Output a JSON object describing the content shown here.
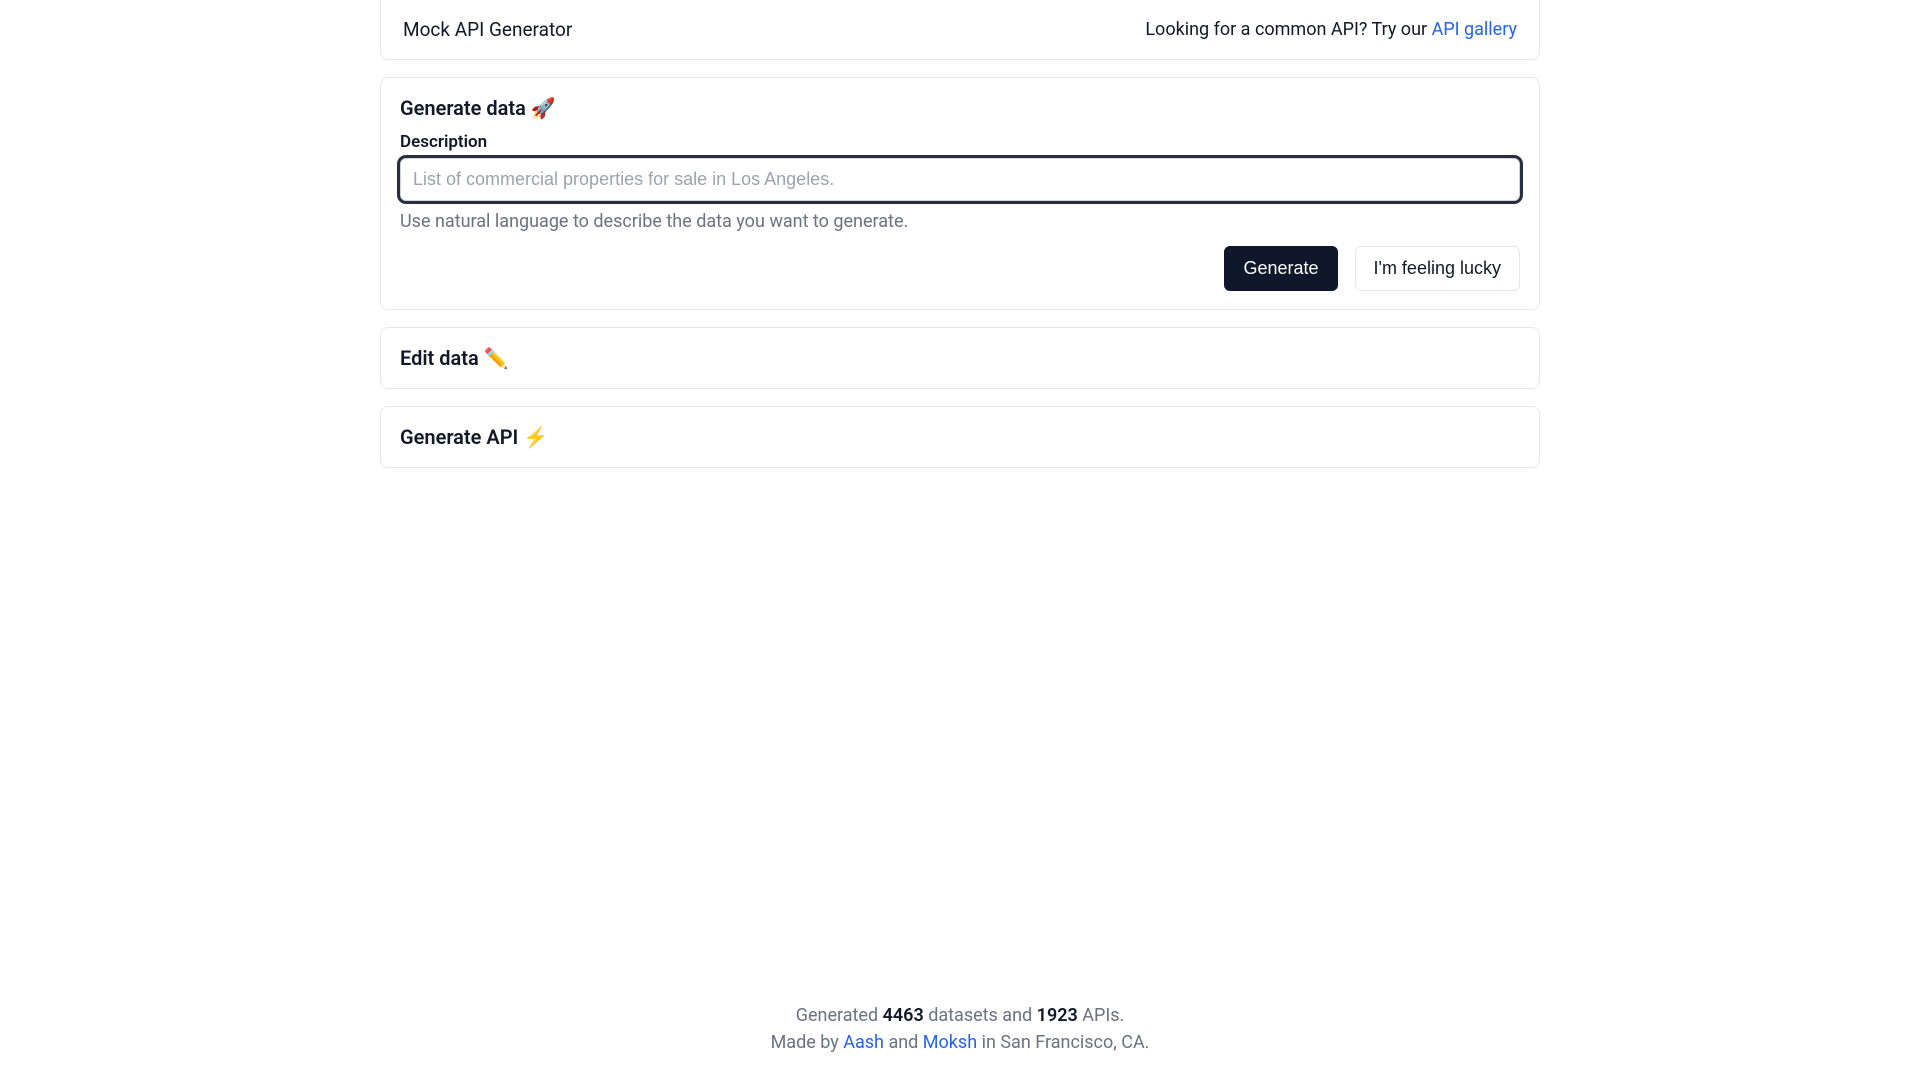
{
  "header": {
    "title": "Mock API Generator",
    "prompt_prefix": "Looking for a common API? Try our ",
    "gallery_link": "API gallery"
  },
  "sections": {
    "generate_data": {
      "title": "Generate data 🚀",
      "description_label": "Description",
      "placeholder": "List of commercial properties for sale in Los Angeles.",
      "helper": "Use natural language to describe the data you want to generate.",
      "generate_btn": "Generate",
      "lucky_btn": "I'm feeling lucky"
    },
    "edit_data": {
      "title": "Edit data ✏️"
    },
    "generate_api": {
      "title": "Generate API ⚡"
    }
  },
  "footer": {
    "generated_prefix": "Generated ",
    "datasets_count": "4463",
    "datasets_mid": " datasets and ",
    "apis_count": "1923",
    "apis_suffix": " APIs.",
    "made_by_prefix": "Made by ",
    "author1": "Aash",
    "and": " and ",
    "author2": "Moksh",
    "location_suffix": " in San Francisco, CA."
  }
}
